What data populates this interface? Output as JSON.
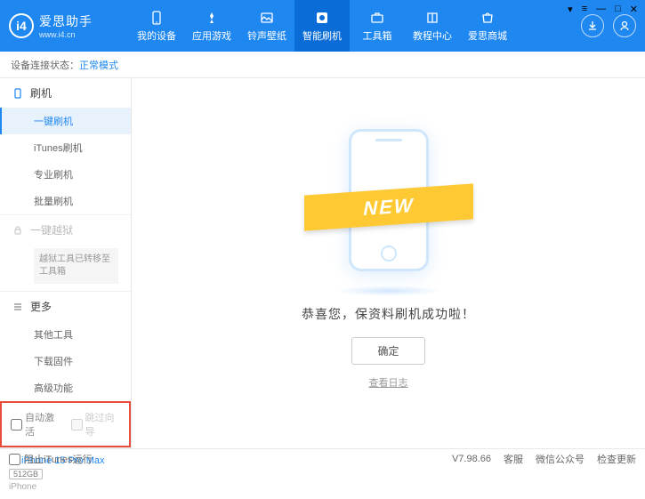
{
  "app": {
    "title": "爱思助手",
    "subtitle": "www.i4.cn"
  },
  "nav": [
    {
      "label": "我的设备"
    },
    {
      "label": "应用游戏"
    },
    {
      "label": "铃声壁纸"
    },
    {
      "label": "智能刷机"
    },
    {
      "label": "工具箱"
    },
    {
      "label": "教程中心"
    },
    {
      "label": "爱思商城"
    }
  ],
  "status": {
    "label": "设备连接状态：",
    "value": "正常模式"
  },
  "sidebar": {
    "flash": {
      "head": "刷机",
      "items": [
        "一键刷机",
        "iTunes刷机",
        "专业刷机",
        "批量刷机"
      ]
    },
    "jailbreak": {
      "head": "一键越狱",
      "note": "越狱工具已转移至工具箱"
    },
    "more": {
      "head": "更多",
      "items": [
        "其他工具",
        "下载固件",
        "高级功能"
      ]
    },
    "checks": {
      "auto": "自动激活",
      "skip": "跳过向导"
    },
    "device": {
      "name": "iPhone 15 Pro Max",
      "storage": "512GB",
      "type": "iPhone"
    }
  },
  "main": {
    "ribbon": "NEW",
    "msg": "恭喜您，保资料刷机成功啦！",
    "ok": "确定",
    "log": "查看日志"
  },
  "footer": {
    "block": "阻止iTunes运行",
    "version": "V7.98.66",
    "links": [
      "客服",
      "微信公众号",
      "检查更新"
    ]
  }
}
